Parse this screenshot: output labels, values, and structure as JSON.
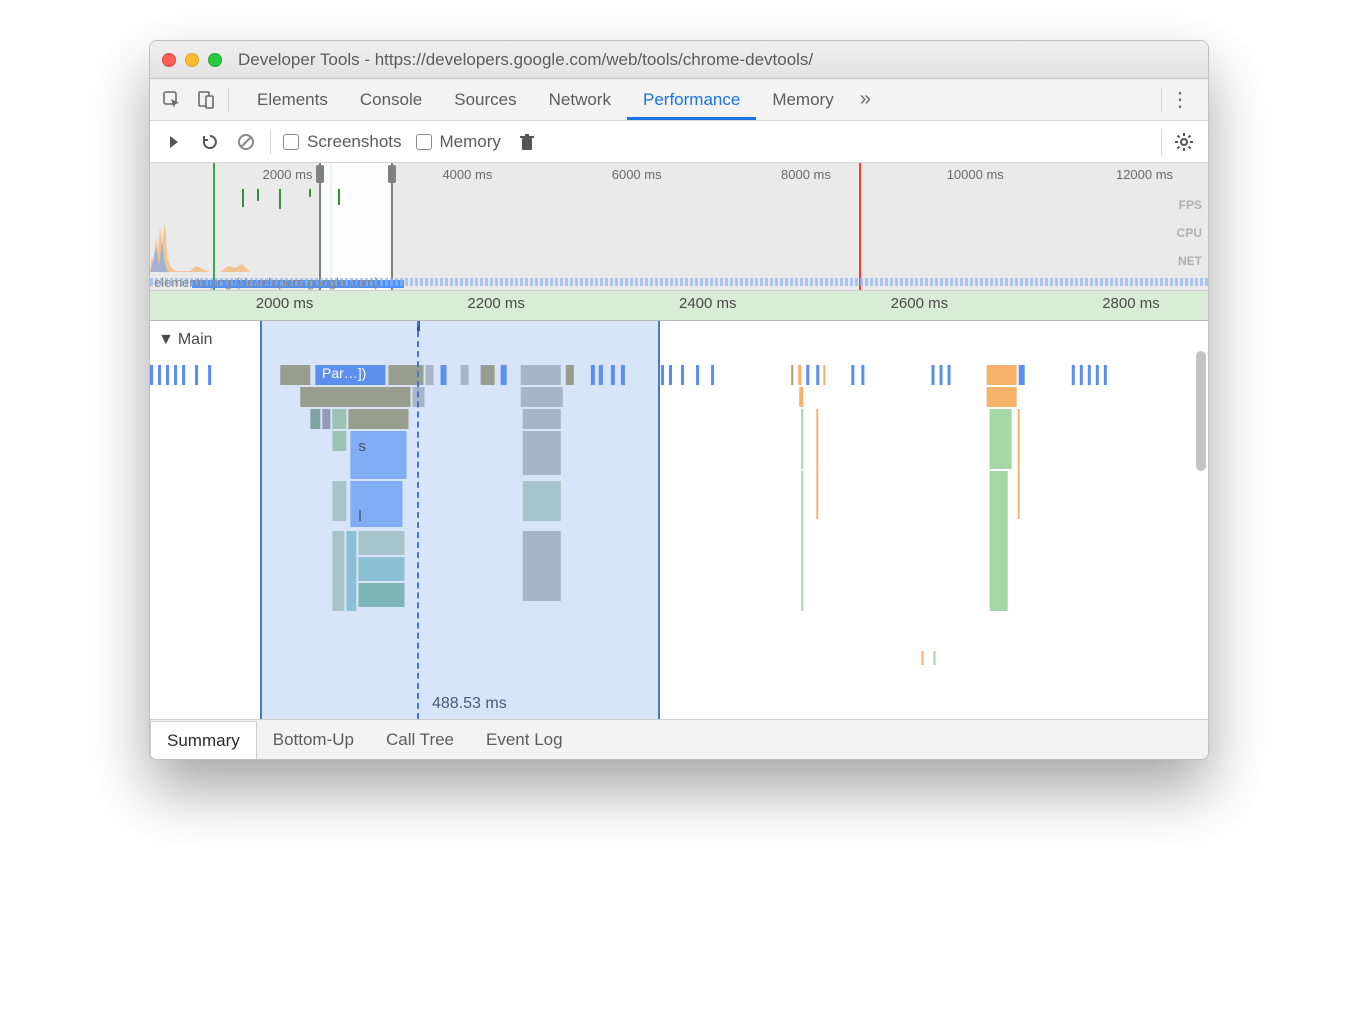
{
  "window_title": "Developer Tools - https://developers.google.com/web/tools/chrome-devtools/",
  "tabs": [
    "Elements",
    "Console",
    "Sources",
    "Network",
    "Performance",
    "Memory"
  ],
  "active_tab": "Performance",
  "toolbar": {
    "screenshots_label": "Screenshots",
    "memory_label": "Memory"
  },
  "overview": {
    "ticks": [
      "2000 ms",
      "4000 ms",
      "6000 ms",
      "8000 ms",
      "10000 ms",
      "12000 ms"
    ],
    "metrics": [
      "FPS",
      "CPU",
      "NET"
    ],
    "net_label": "elements.png (developers.google.com)"
  },
  "ruler": {
    "ticks": [
      "2000 ms",
      "2200 ms",
      "2400 ms",
      "2600 ms",
      "2800 ms"
    ]
  },
  "flame": {
    "main_label": "Main",
    "task_short": "Par…])",
    "s_label": "s",
    "l_label": "l",
    "selection_duration": "488.53 ms"
  },
  "bottom_tabs": [
    "Summary",
    "Bottom-Up",
    "Call Tree",
    "Event Log"
  ],
  "active_bottom_tab": "Summary"
}
